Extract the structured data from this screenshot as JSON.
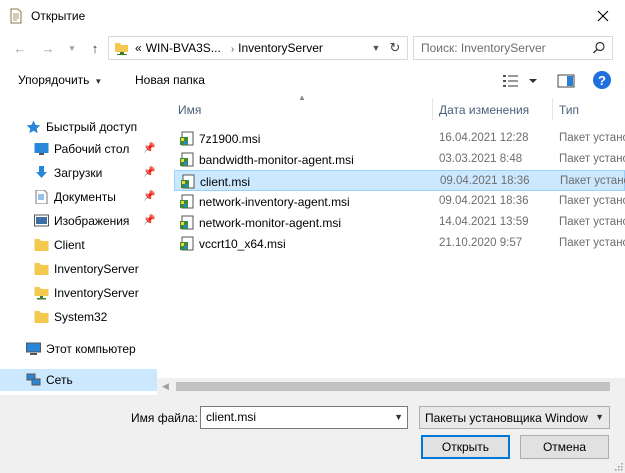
{
  "window": {
    "title": "Открытие"
  },
  "address": {
    "prefix": "«",
    "segment1": "WIN-BVA3S...",
    "segment2": "InventoryServer"
  },
  "search": {
    "placeholder": "Поиск: InventoryServer"
  },
  "toolbar": {
    "organize": "Упорядочить",
    "new_folder": "Новая папка",
    "help": "?"
  },
  "sidebar": {
    "items": [
      {
        "label": "Быстрый доступ",
        "icon": "star-icon"
      },
      {
        "label": "Рабочий стол",
        "icon": "desktop-icon"
      },
      {
        "label": "Загрузки",
        "icon": "download-icon"
      },
      {
        "label": "Документы",
        "icon": "documents-icon"
      },
      {
        "label": "Изображения",
        "icon": "pictures-icon"
      },
      {
        "label": "Client",
        "icon": "folder-icon"
      },
      {
        "label": "InventoryServer",
        "icon": "folder-icon"
      },
      {
        "label": "InventoryServer",
        "icon": "network-folder-icon"
      },
      {
        "label": "System32",
        "icon": "folder-icon"
      },
      {
        "label": "Этот компьютер",
        "icon": "computer-icon"
      },
      {
        "label": "Сеть",
        "icon": "network-icon"
      }
    ]
  },
  "columns": {
    "name": "Имя",
    "date": "Дата изменения",
    "type": "Тип"
  },
  "files": [
    {
      "name": "7z1900.msi",
      "date": "16.04.2021 12:28",
      "type": "Пакет установщика Windows"
    },
    {
      "name": "bandwidth-monitor-agent.msi",
      "date": "03.03.2021 8:48",
      "type": "Пакет установщика Windows"
    },
    {
      "name": "client.msi",
      "date": "09.04.2021 18:36",
      "type": "Пакет установщика Windows"
    },
    {
      "name": "network-inventory-agent.msi",
      "date": "09.04.2021 18:36",
      "type": "Пакет установщика Windows"
    },
    {
      "name": "network-monitor-agent.msi",
      "date": "14.04.2021 13:59",
      "type": "Пакет установщика Windows"
    },
    {
      "name": "vccrt10_x64.msi",
      "date": "21.10.2020 9:57",
      "type": "Пакет установщика Windows"
    }
  ],
  "footer": {
    "filename_label": "Имя файла:",
    "filename_value": "client.msi",
    "filter_value": "Пакеты установщика Window",
    "open_label": "Открыть",
    "cancel_label": "Отмена"
  },
  "colors": {
    "selection": "#cce8ff",
    "accent": "#0078d7"
  }
}
